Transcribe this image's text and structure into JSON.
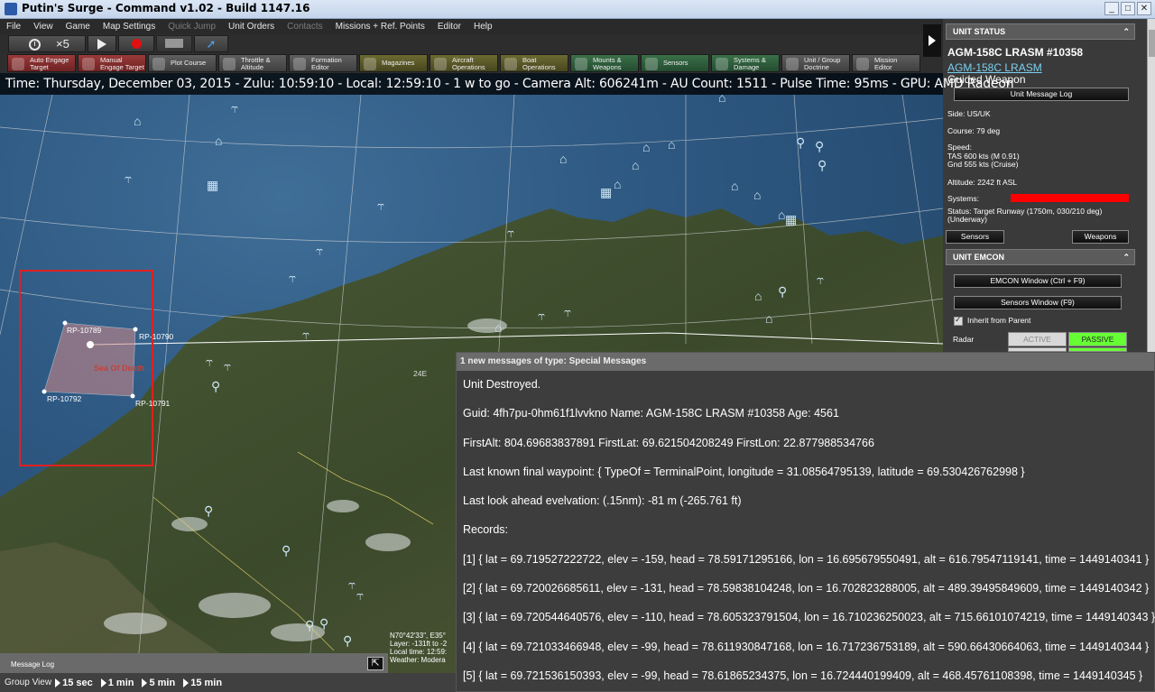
{
  "window": {
    "title": "Putin's Surge - Command v1.02 - Build 1147.16",
    "buttons": [
      "_",
      "□",
      "✕"
    ]
  },
  "menu": [
    "File",
    "View",
    "Game",
    "Map Settings",
    "Quick Jump",
    "Unit Orders",
    "Contacts",
    "Missions + Ref. Points",
    "Editor",
    "Help"
  ],
  "timecontrols": {
    "compression": "×5"
  },
  "toolbar": [
    {
      "label": "Auto Engage\nTarget",
      "color": "red"
    },
    {
      "label": "Manual\nEngage Target",
      "color": "red"
    },
    {
      "label": "Plot Course",
      "color": "gray"
    },
    {
      "label": "Throttle &\nAltitude",
      "color": "gray"
    },
    {
      "label": "Formation\nEditor",
      "color": "gray"
    },
    {
      "label": "Magazines",
      "color": "olive"
    },
    {
      "label": "Aircraft\nOperations",
      "color": "olive"
    },
    {
      "label": "Boat\nOperations",
      "color": "olive"
    },
    {
      "label": "Mounts &\nWeapons",
      "color": "green"
    },
    {
      "label": "Sensors",
      "color": "green"
    },
    {
      "label": "Systems &\nDamage",
      "color": "green"
    },
    {
      "label": "Unit / Group\nDoctrine",
      "color": "gray"
    },
    {
      "label": "Mission\nEditor",
      "color": "gray"
    }
  ],
  "info_strip": "Time: Thursday, December 03, 2015 - Zulu: 10:59:10 - Local: 12:59:10 - 1 w to go -  Camera Alt: 606241m  - AU Count: 1511  - Pulse Time: 95ms  - GPU: AMD Radeon",
  "map": {
    "ref_points": [
      "RP-10789",
      "RP-10790",
      "RP-10792",
      "RP-10791"
    ],
    "area_label": "Sea Of Death",
    "grid_labels": [
      "24E"
    ],
    "coord_readout": [
      "N70°42'33\", E35°",
      "Layer: -131ft to -2",
      "Local time: 12:59:",
      "Weather: Modera"
    ],
    "message_log_label": "Message Log"
  },
  "group_view": {
    "label": "Group View",
    "steps": [
      "15 sec",
      "1 min",
      "5 min",
      "15 min"
    ]
  },
  "unit_status": {
    "header": "UNIT STATUS",
    "name": "AGM-158C LRASM #10358",
    "class_link": "AGM-158C LRASM",
    "type": "Guided Weapon",
    "message_log_btn": "Unit Message Log",
    "side": "Side: US/UK",
    "course": "Course: 79 deg",
    "speed_label": "Speed:",
    "speed_tas": "TAS 600 kts (M 0.91)",
    "speed_gnd": "Gnd 555 kts (Cruise)",
    "altitude": "Altitude: 2242 ft ASL",
    "systems_label": "Systems:",
    "status_line1": "Status: Target Runway (1750m, 030/210 deg)",
    "status_line2": "(Underway)",
    "sensors_btn": "Sensors",
    "weapons_btn": "Weapons"
  },
  "emcon": {
    "header": "UNIT EMCON",
    "emcon_window_btn": "EMCON Window (Ctrl + F9)",
    "sensors_window_btn": "Sensors Window (F9)",
    "inherit_label": "Inherit from Parent",
    "radar_label": "Radar",
    "active_label": "ACTIVE",
    "passive_label": "PASSIVE"
  },
  "message": {
    "title": "1 new messages of type: Special Messages",
    "lines": [
      "Unit Destroyed.",
      "Guid: 4fh7pu-0hm61f1lvvkno   Name: AGM-158C LRASM #10358   Age: 4561",
      "FirstAlt: 804.69683837891   FirstLat: 69.621504208249   FirstLon: 22.877988534766",
      "Last known final waypoint: { TypeOf = TerminalPoint, longitude = 31.08564795139, latitude = 69.530426762998 }",
      "Last look ahead evelvation: (.15nm): -81 m (-265.761 ft)",
      "Records:",
      "[1] { lat = 69.719527222722, elev = -159, head = 78.59171295166, lon = 16.695679550491, alt = 616.79547119141, time = 1449140341 }",
      "[2] { lat = 69.720026685611, elev = -131, head = 78.59838104248, lon = 16.702823288005, alt = 489.39495849609, time = 1449140342 }",
      "[3] { lat = 69.720544640576, elev = -110, head = 78.605323791504, lon = 16.710236250023, alt = 715.66101074219, time = 1449140343 }",
      "[4] { lat = 69.721033466948, elev = -99, head = 78.611930847168, lon = 16.717236753189, alt = 590.66430664063, time = 1449140344 }",
      "[5] { lat = 69.721536150393, elev = -99, head = 78.61865234375, lon = 16.724440199409, alt = 468.45761108398, time = 1449140345 }"
    ]
  },
  "colors": {
    "sea": "#2f5a84",
    "land": "#3a4a2a",
    "unit": "#cfe7f7",
    "selection": "#e02020",
    "passive": "#66ff33",
    "systems_bar": "#ff0000"
  }
}
